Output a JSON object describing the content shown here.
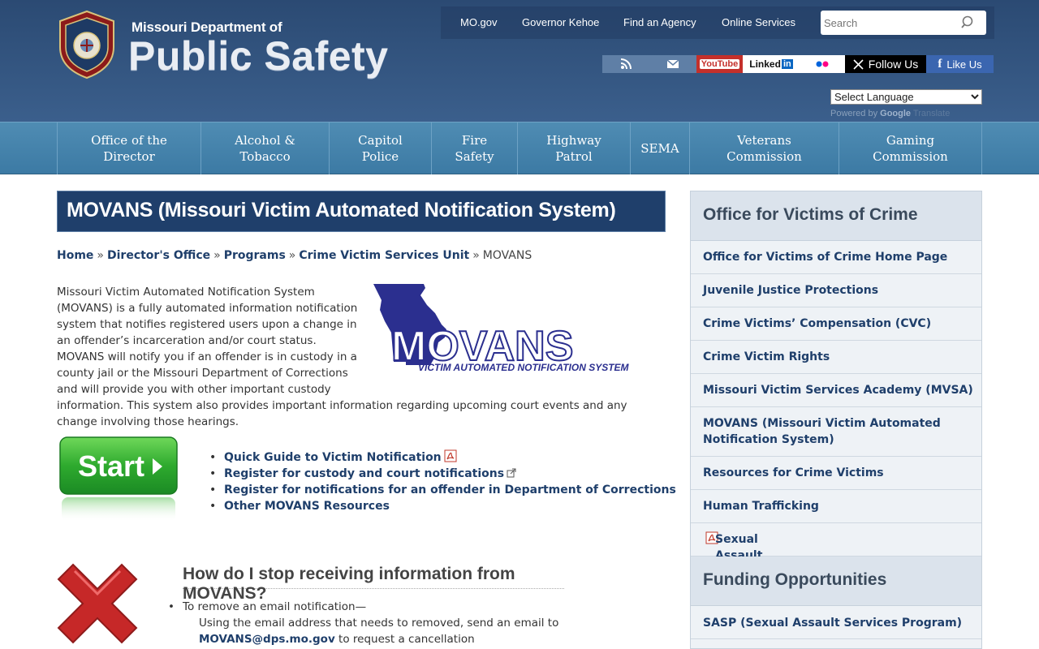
{
  "header": {
    "org_line1": "Missouri Department of",
    "org_line2": "Public Safety",
    "top_links": [
      "MO.gov",
      "Governor Kehoe",
      "Find an Agency",
      "Online Services"
    ],
    "search_placeholder": "Search",
    "social": {
      "rss": "rss-icon",
      "email": "email-icon",
      "youtube": "YouTube",
      "linkedin": "Linked",
      "linkedin_in": "in",
      "flickr": "flickr-icon",
      "x_follow": "Follow Us",
      "facebook_like": "Like Us"
    },
    "language_select": "Select Language",
    "powered_by": "Powered by",
    "google": "Google",
    "translate": "Translate"
  },
  "nav": {
    "items": [
      {
        "line1": "Office of the",
        "line2": "Director"
      },
      {
        "line1": "Alcohol &",
        "line2": "Tobacco"
      },
      {
        "line1": "Capitol",
        "line2": "Police"
      },
      {
        "line1": "Fire",
        "line2": "Safety"
      },
      {
        "line1": "Highway",
        "line2": "Patrol"
      },
      {
        "line1": "SEMA",
        "line2": ""
      },
      {
        "line1": "Veterans",
        "line2": "Commission"
      },
      {
        "line1": "Gaming",
        "line2": "Commission"
      }
    ]
  },
  "main": {
    "title": "MOVANS (Missouri Victim Automated Notification System)",
    "breadcrumb": {
      "items": [
        "Home",
        "Director's Office",
        "Programs",
        "Crime Victim Services Unit"
      ],
      "current": "MOVANS",
      "separator": "»"
    },
    "intro": "Missouri Victim Automated Notification System (MOVANS) is a fully automated information notification system that notifies registered users upon a change in an offender’s incarceration and/or court status. MOVANS will notify you if an offender is in custody in a county jail or the Missouri Department of Corrections and will provide you with other important custody information. This system also provides important information regarding upcoming court events and any change involving those hearings.",
    "logo": {
      "word": "MOVANS",
      "tagline": "VICTIM AUTOMATED NOTIFICATION SYSTEM"
    },
    "start_label": "Start",
    "resources": [
      "Quick Guide to Victim Notification",
      "Register for custody and court notifications",
      "Register for notifications for an offender in Department of Corrections",
      "Other MOVANS Resources"
    ],
    "stop_heading": "How do I stop receiving information from MOVANS?",
    "stop_line1": "To remove an email notification—",
    "stop_line2": "Using the email address that needs to removed, send an email to",
    "stop_email": "MOVANS@dps.mo.gov",
    "stop_line3_rest": " to request a cancellation"
  },
  "sidebar": {
    "section1_title": "Office for Victims of Crime",
    "section1_items": [
      "Office for Victims of Crime Home Page",
      "Juvenile Justice Protections",
      "Crime Victims’ Compensation (CVC)",
      "Crime Victim Rights",
      "Missouri Victim Services Academy (MVSA)",
      "MOVANS (Missouri Victim Automated",
      "Notification System)",
      "Resources for Crime Victims",
      "Human Trafficking",
      "Sexual Assault Survivors Bill of Rights"
    ],
    "section2_title": "Funding Opportunities",
    "section2_items": [
      "SASP (Sexual Assault Services Program)"
    ]
  },
  "colors": {
    "header_blue": "#2b4a73",
    "nav_blue": "#4f8cb3",
    "title_bar": "#1f3f6b",
    "link": "#1f3f6b",
    "youtube_red": "#c4302b",
    "facebook_blue": "#3b66b0"
  }
}
